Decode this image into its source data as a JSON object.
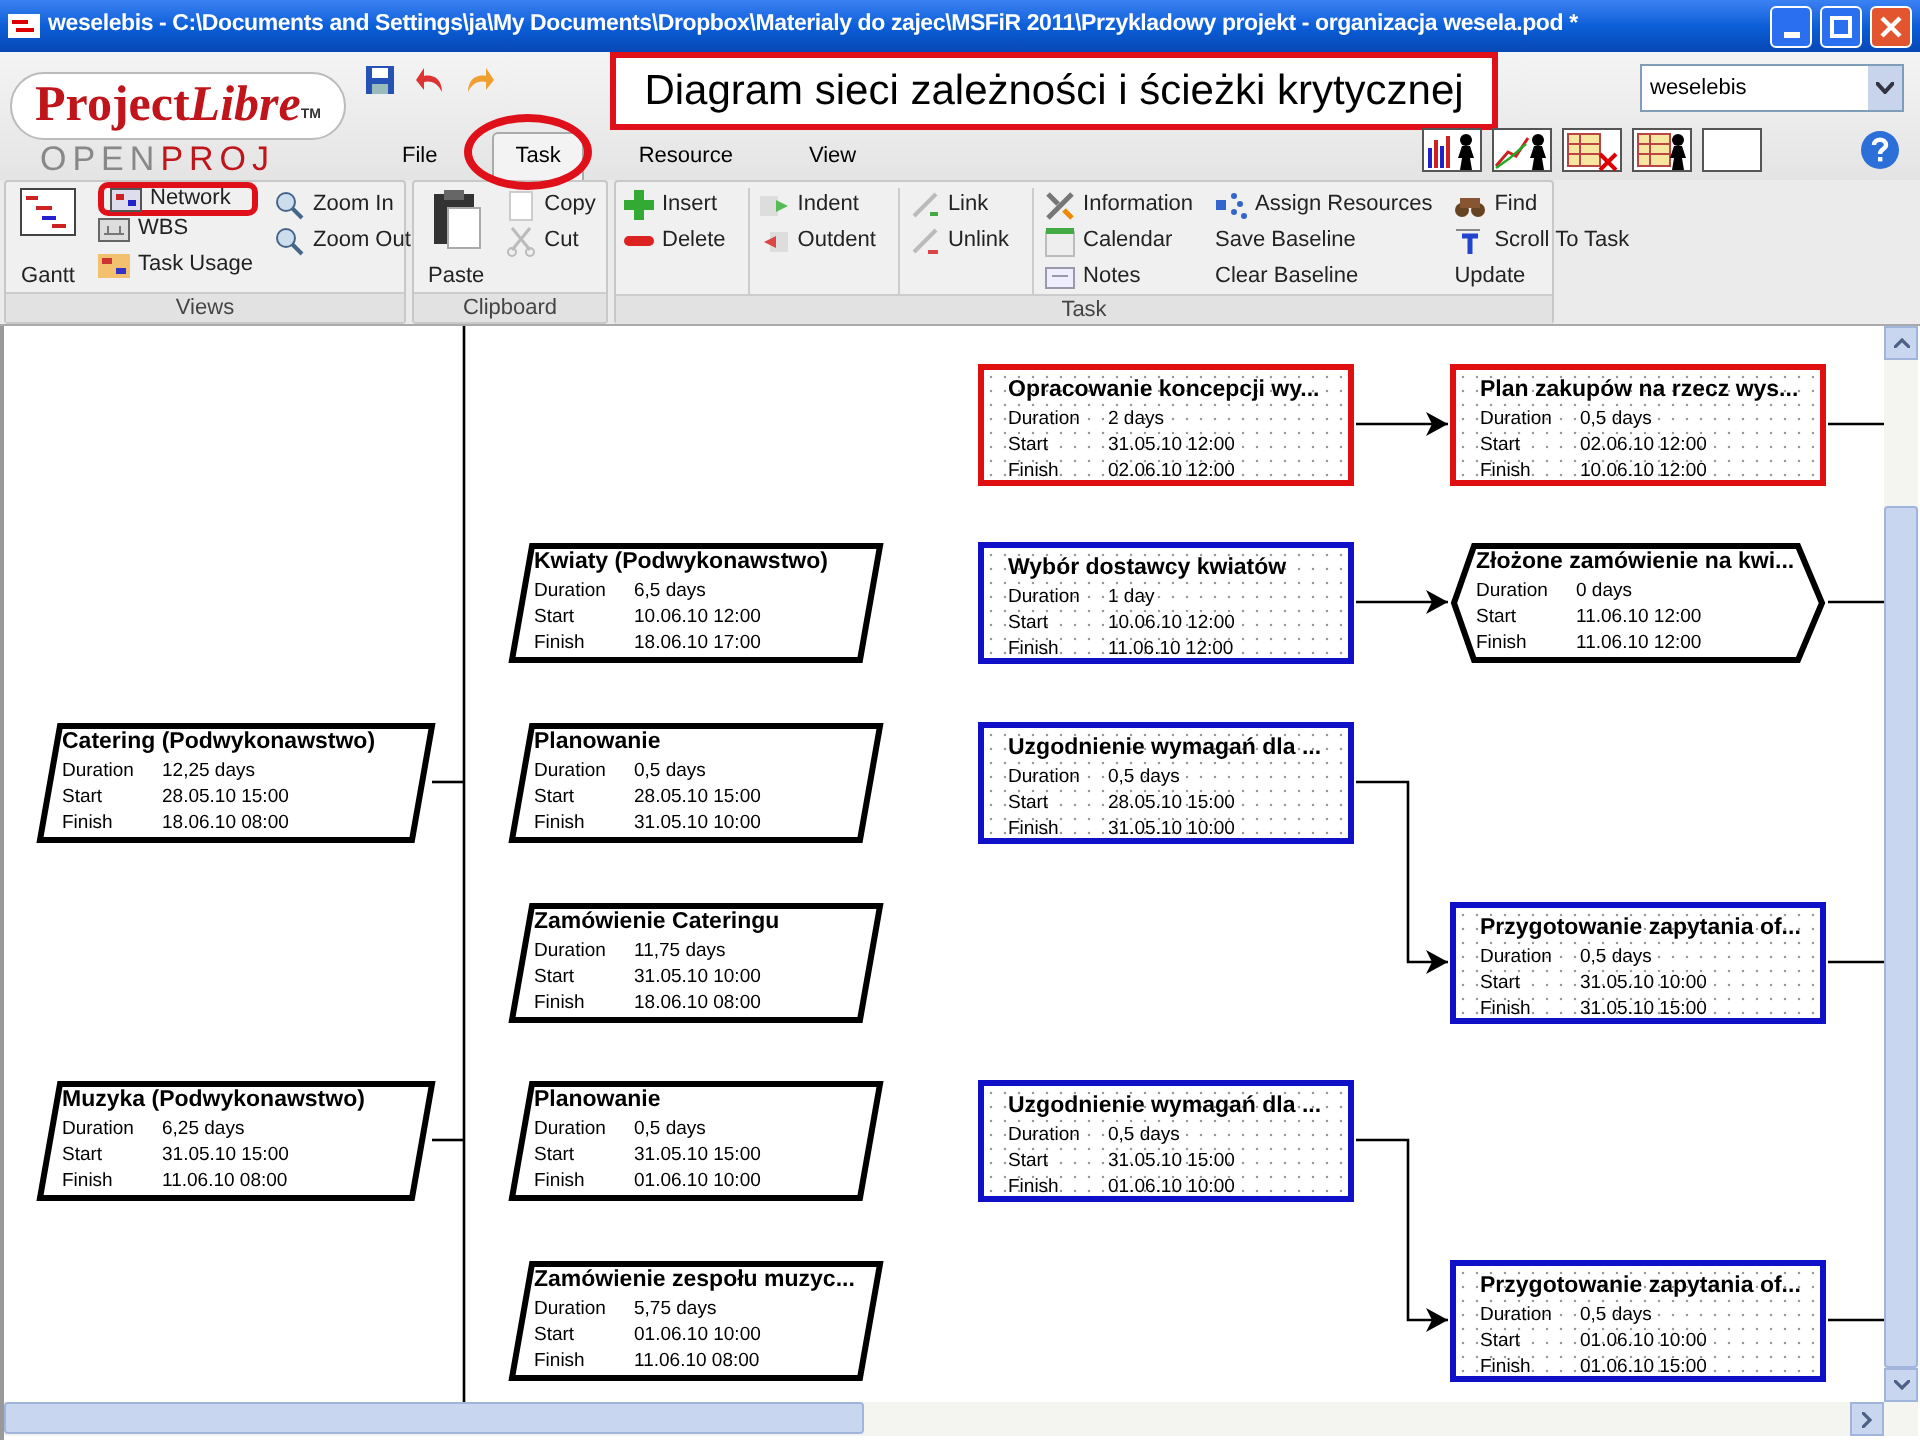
{
  "window": {
    "title": "weselebis - C:\\Documents and Settings\\ja\\My Documents\\Dropbox\\Materialy do zajec\\MSFiR 2011\\Przykladowy projekt - organizacja wesela.pod *"
  },
  "logo": {
    "text_1": "Project",
    "text_2": "Libre",
    "mark": "TM",
    "subtitle_1": "OPEN",
    "subtitle_2": "PROJ"
  },
  "annotation": {
    "text": "Diagram sieci zależności i ścieżki krytycznej"
  },
  "tabs": [
    {
      "label": "File",
      "selected": false,
      "circled": false
    },
    {
      "label": "Task",
      "selected": true,
      "circled": true
    },
    {
      "label": "Resource",
      "selected": false,
      "circled": false
    },
    {
      "label": "View",
      "selected": false,
      "circled": false
    }
  ],
  "project_selector": {
    "value": "weselebis"
  },
  "ribbon": {
    "groups": [
      {
        "label": "Views",
        "columns": [
          [
            {
              "label": "Gantt",
              "kind": "large",
              "highlighted": false
            }
          ],
          [
            {
              "label": "Network",
              "kind": "small",
              "highlighted": true
            },
            {
              "label": "WBS",
              "kind": "small",
              "highlighted": false
            },
            {
              "label": "Task Usage",
              "kind": "small",
              "highlighted": false
            }
          ],
          [
            {
              "label": "Zoom In",
              "kind": "small",
              "highlighted": false
            },
            {
              "label": "Zoom Out",
              "kind": "small",
              "highlighted": false
            }
          ]
        ]
      },
      {
        "label": "Clipboard",
        "columns": [
          [
            {
              "label": "Paste",
              "kind": "large",
              "highlighted": false
            }
          ],
          [
            {
              "label": "Copy",
              "kind": "small",
              "highlighted": false
            },
            {
              "label": "Cut",
              "kind": "small",
              "highlighted": false
            }
          ]
        ]
      },
      {
        "label": "Task",
        "columns": [
          [
            {
              "label": "Insert",
              "kind": "small",
              "highlighted": false
            },
            {
              "label": "Delete",
              "kind": "small",
              "highlighted": false
            }
          ],
          [
            {
              "label": "Indent",
              "kind": "small",
              "highlighted": false
            },
            {
              "label": "Outdent",
              "kind": "small",
              "highlighted": false
            }
          ],
          [
            {
              "label": "Link",
              "kind": "small",
              "highlighted": false
            },
            {
              "label": "Unlink",
              "kind": "small",
              "highlighted": false
            }
          ],
          [
            {
              "label": "Information",
              "kind": "small",
              "highlighted": false
            },
            {
              "label": "Calendar",
              "kind": "small",
              "highlighted": false
            },
            {
              "label": "Notes",
              "kind": "small",
              "highlighted": false
            }
          ],
          [
            {
              "label": "Assign Resources",
              "kind": "small",
              "highlighted": false
            },
            {
              "label": "Save Baseline",
              "kind": "plain",
              "highlighted": false
            },
            {
              "label": "Clear Baseline",
              "kind": "plain",
              "highlighted": false
            }
          ],
          [
            {
              "label": "Find",
              "kind": "small",
              "highlighted": false
            },
            {
              "label": "Scroll To Task",
              "kind": "small",
              "highlighted": false
            },
            {
              "label": "Update",
              "kind": "plain",
              "highlighted": false
            }
          ]
        ]
      }
    ]
  },
  "diagram": {
    "columns": [
      {
        "nodes": [
          {
            "kind": "summary",
            "title": "Catering (Podwykonawstwo)",
            "rows": [
              {
                "label": "Duration",
                "value": "12,25 days"
              },
              {
                "label": "Start",
                "value": "28.05.10 15:00"
              },
              {
                "label": "Finish",
                "value": "18.06.10 08:00"
              }
            ]
          },
          {
            "kind": "summary",
            "title": "Muzyka (Podwykonawstwo)",
            "rows": [
              {
                "label": "Duration",
                "value": "6,25 days"
              },
              {
                "label": "Start",
                "value": "31.05.10 15:00"
              },
              {
                "label": "Finish",
                "value": "11.06.10 08:00"
              }
            ]
          }
        ]
      },
      {
        "nodes": [
          {
            "kind": "summary",
            "title": "Kwiaty (Podwykonawstwo)",
            "rows": [
              {
                "label": "Duration",
                "value": "6,5 days"
              },
              {
                "label": "Start",
                "value": "10.06.10 12:00"
              },
              {
                "label": "Finish",
                "value": "18.06.10 17:00"
              }
            ]
          },
          {
            "kind": "summary",
            "title": "Planowanie",
            "rows": [
              {
                "label": "Duration",
                "value": "0,5 days"
              },
              {
                "label": "Start",
                "value": "28.05.10 15:00"
              },
              {
                "label": "Finish",
                "value": "31.05.10 10:00"
              }
            ]
          },
          {
            "kind": "summary",
            "title": "Zamówienie Cateringu",
            "rows": [
              {
                "label": "Duration",
                "value": "11,75 days"
              },
              {
                "label": "Start",
                "value": "31.05.10 10:00"
              },
              {
                "label": "Finish",
                "value": "18.06.10 08:00"
              }
            ]
          },
          {
            "kind": "summary",
            "title": "Planowanie",
            "rows": [
              {
                "label": "Duration",
                "value": "0,5 days"
              },
              {
                "label": "Start",
                "value": "31.05.10 15:00"
              },
              {
                "label": "Finish",
                "value": "01.06.10 10:00"
              }
            ]
          },
          {
            "kind": "summary",
            "title": "Zamówienie zespołu muzyc...",
            "rows": [
              {
                "label": "Duration",
                "value": "5,75 days"
              },
              {
                "label": "Start",
                "value": "01.06.10 10:00"
              },
              {
                "label": "Finish",
                "value": "11.06.10 08:00"
              }
            ]
          }
        ]
      },
      {
        "nodes": [
          {
            "kind": "task",
            "critical": true,
            "title": "Opracowanie koncepcji wy...",
            "rows": [
              {
                "label": "Duration",
                "value": "2 days"
              },
              {
                "label": "Start",
                "value": "31.05.10 12:00"
              },
              {
                "label": "Finish",
                "value": "02.06.10 12:00"
              }
            ]
          },
          {
            "kind": "task",
            "critical": false,
            "title": "Wybór dostawcy kwiatów",
            "rows": [
              {
                "label": "Duration",
                "value": "1 day"
              },
              {
                "label": "Start",
                "value": "10.06.10 12:00"
              },
              {
                "label": "Finish",
                "value": "11.06.10 12:00"
              }
            ]
          },
          {
            "kind": "task",
            "critical": false,
            "title": "Uzgodnienie wymagań dla ...",
            "rows": [
              {
                "label": "Duration",
                "value": "0,5 days"
              },
              {
                "label": "Start",
                "value": "28.05.10 15:00"
              },
              {
                "label": "Finish",
                "value": "31.05.10 10:00"
              }
            ]
          },
          {
            "kind": "task",
            "critical": false,
            "title": "Uzgodnienie wymagań dla ...",
            "rows": [
              {
                "label": "Duration",
                "value": "0,5 days"
              },
              {
                "label": "Start",
                "value": "31.05.10 15:00"
              },
              {
                "label": "Finish",
                "value": "01.06.10 10:00"
              }
            ]
          }
        ]
      },
      {
        "nodes": [
          {
            "kind": "task",
            "critical": true,
            "title": "Plan zakupów na rzecz wys...",
            "rows": [
              {
                "label": "Duration",
                "value": "0,5 days"
              },
              {
                "label": "Start",
                "value": "02.06.10 12:00"
              },
              {
                "label": "Finish",
                "value": "10.06.10 12:00"
              }
            ]
          },
          {
            "kind": "milestone",
            "title": "Złożone zamówienie na kwi...",
            "rows": [
              {
                "label": "Duration",
                "value": "0 days"
              },
              {
                "label": "Start",
                "value": "11.06.10 12:00"
              },
              {
                "label": "Finish",
                "value": "11.06.10 12:00"
              }
            ]
          },
          {
            "kind": "task",
            "critical": false,
            "title": "Przygotowanie zapytania of...",
            "rows": [
              {
                "label": "Duration",
                "value": "0,5 days"
              },
              {
                "label": "Start",
                "value": "31.05.10 10:00"
              },
              {
                "label": "Finish",
                "value": "31.05.10 15:00"
              }
            ]
          },
          {
            "kind": "task",
            "critical": false,
            "title": "Przygotowanie zapytania of...",
            "rows": [
              {
                "label": "Duration",
                "value": "0,5 days"
              },
              {
                "label": "Start",
                "value": "01.06.10 10:00"
              },
              {
                "label": "Finish",
                "value": "01.06.10 15:00"
              }
            ]
          }
        ]
      }
    ]
  }
}
